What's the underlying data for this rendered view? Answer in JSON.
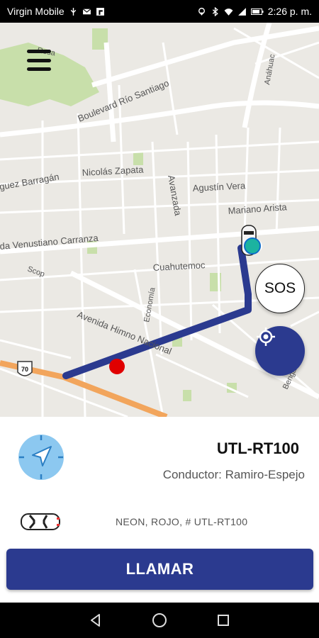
{
  "status_bar": {
    "carrier": "Virgin Mobile",
    "time": "2:26 p. m.",
    "icons": [
      "usb-icon",
      "mail-icon",
      "flipboard-icon",
      "location-icon",
      "bluetooth-icon",
      "wifi-icon",
      "signal-icon",
      "battery-icon"
    ]
  },
  "map": {
    "streets": {
      "boulevard": "Boulevard Río Santiago",
      "barragan": "guez Barragán",
      "zapata": "Nicolás Zapata",
      "avanzada": "Avanzada",
      "agustin": "Agustín Vera",
      "mariano": "Mariano Arista",
      "carranza": "da Venustiano Carranza",
      "cuauhtemoc": "Cuahutemoc",
      "scop": "Scop",
      "economia": "Economía",
      "himno": "Avenida Himno Nacional",
      "anahuac": "Anáhuac",
      "bengala": "Bengala",
      "rosa": "Rosa",
      "highway": "70"
    },
    "sos_label": "SOS",
    "colors": {
      "route": "#2b3a8f",
      "highway": "#f2a55c",
      "destination": "#e00000",
      "park": "#c8dfaa"
    }
  },
  "trip": {
    "plate": "UTL-RT100",
    "driver": "Conductor: Ramiro-Espejo",
    "vehicle": "NEON, ROJO, # UTL-RT100",
    "call_label": "LLAMAR"
  },
  "nav_bar": {
    "buttons": [
      "back-icon",
      "home-icon",
      "recents-icon"
    ]
  }
}
